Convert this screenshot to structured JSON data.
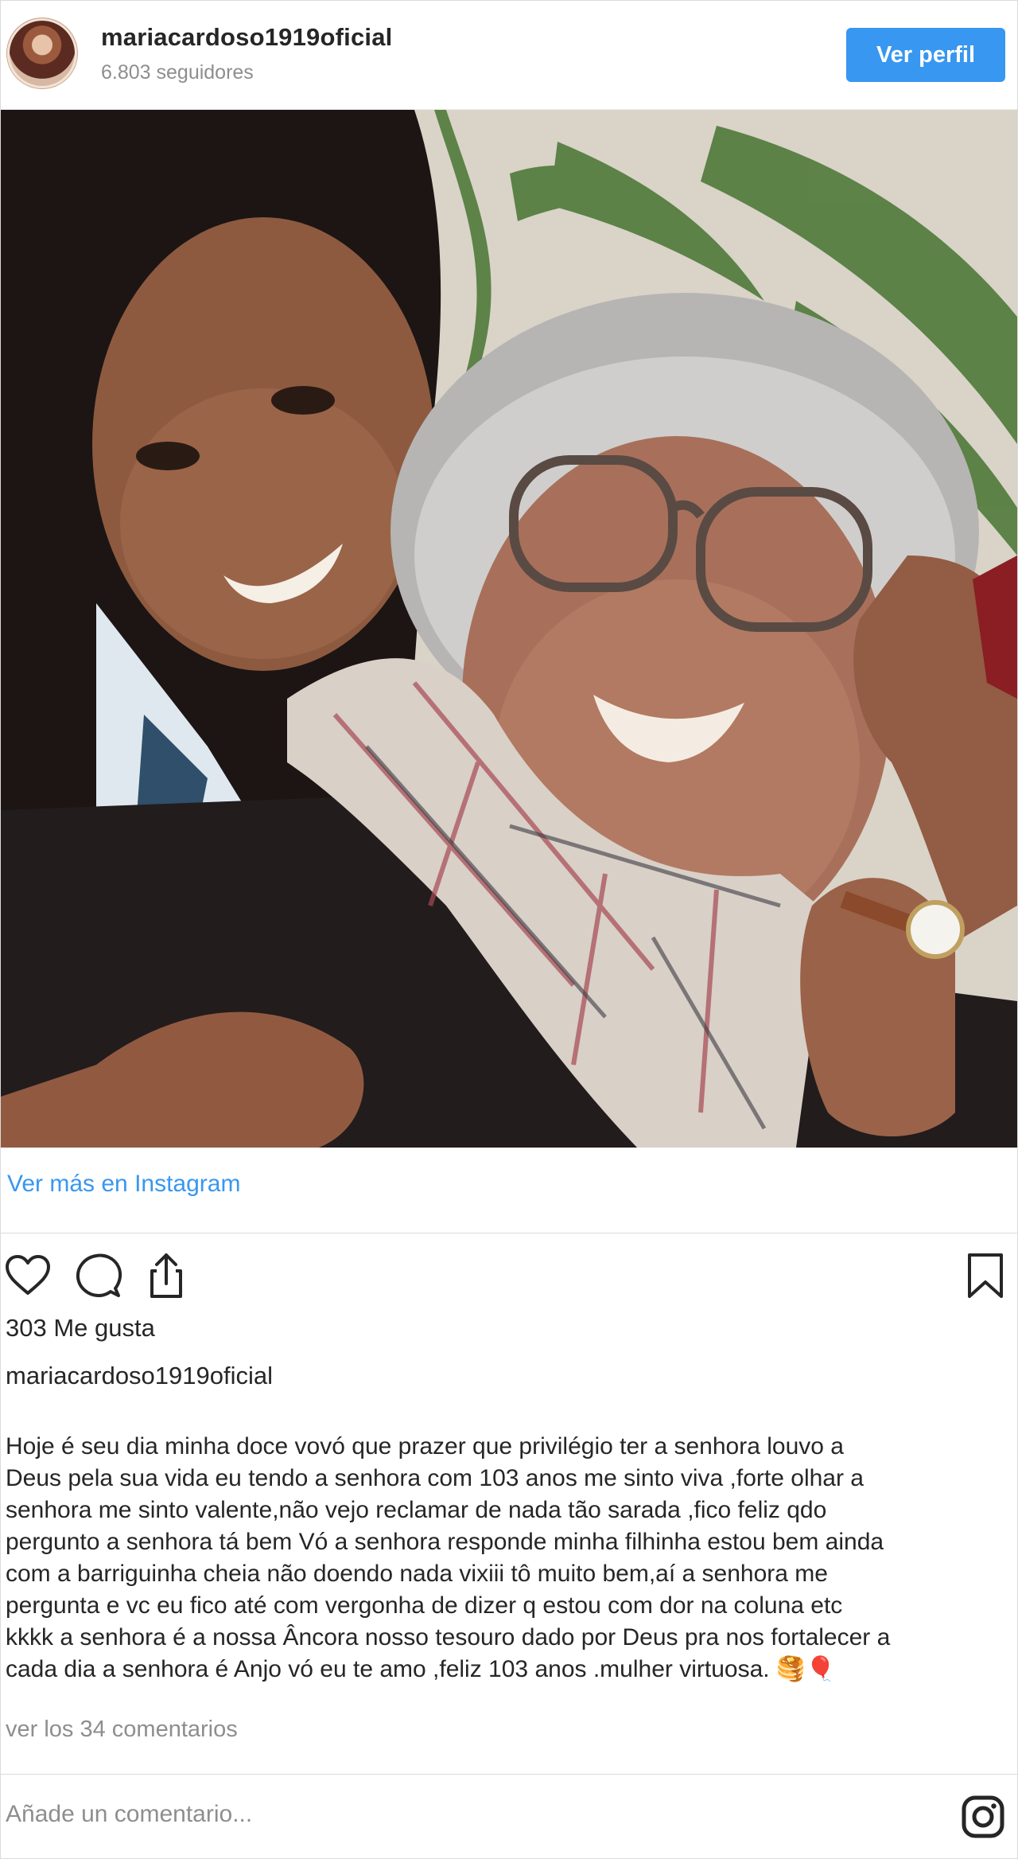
{
  "header": {
    "username": "mariacardoso1919oficial",
    "followers": "6.803 seguidores",
    "view_profile_label": "Ver perfil"
  },
  "post": {
    "more_link": "Ver más en Instagram",
    "likes": "303 Me gusta",
    "caption_username": "mariacardoso1919oficial",
    "caption_text": "Hoje é seu dia minha doce vovó que prazer que privilégio ter a senhora louvo a\nDeus pela sua vida eu tendo a senhora com 103 anos me sinto viva ,forte olhar a\nsenhora me sinto valente,não vejo reclamar de nada tão sarada ,fico feliz qdo\npergunto a senhora tá bem Vó a senhora responde minha filhinha estou bem ainda\ncom a barriguinha cheia não doendo nada vixiii tô muito bem,aí a senhora me\npergunta e vc eu fico até com vergonha de dizer q estou com dor na coluna etc\nkkkk a senhora é a nossa Âncora nosso tesouro dado por Deus pra nos fortalecer a\ncada dia a senhora é Anjo vó eu te amo ,feliz 103 anos .mulher virtuosa. 🥞🎈",
    "view_comments": "ver los 34 comentarios",
    "comment_placeholder": "Añade un comentario..."
  },
  "icons": {
    "like": "heart-icon",
    "comment": "comment-icon",
    "share": "share-icon",
    "save": "bookmark-icon",
    "brand": "instagram-icon"
  },
  "colors": {
    "accent": "#3897f0",
    "text": "#262626",
    "muted": "#8e8e8e",
    "border": "#dbdbdb"
  }
}
